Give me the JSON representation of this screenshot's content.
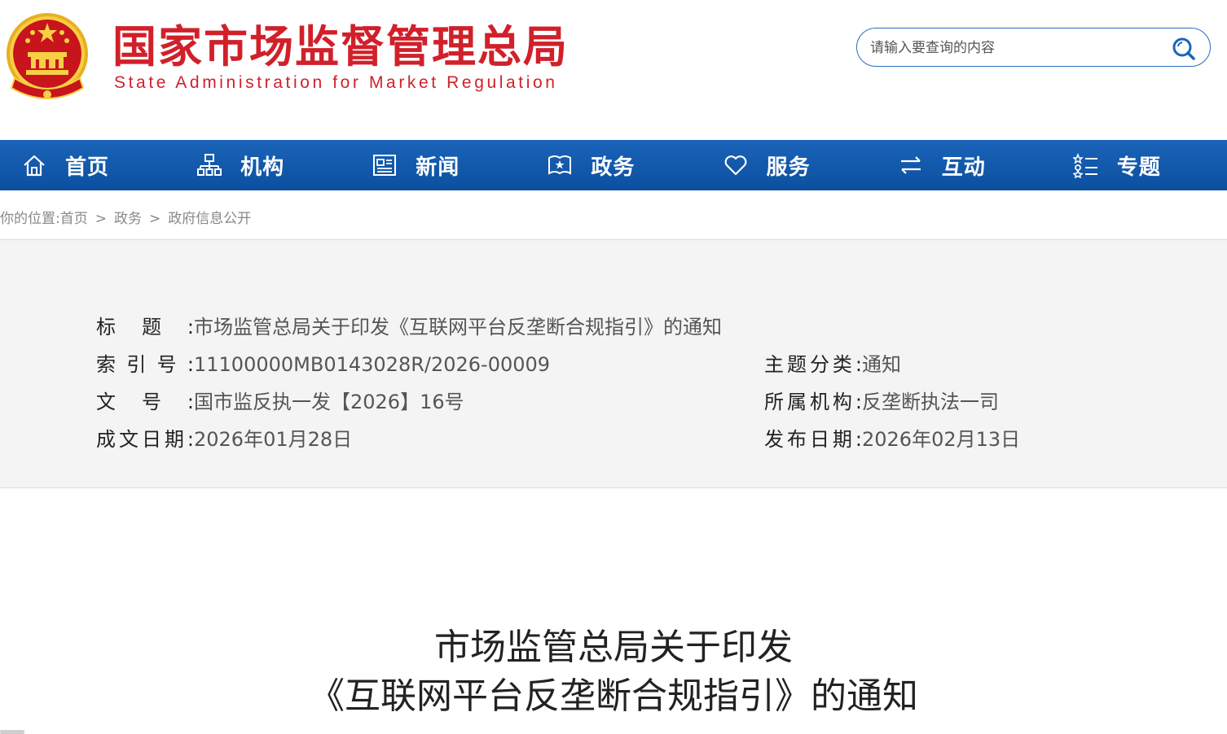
{
  "header": {
    "site_name_cn": "国家市场监督管理总局",
    "site_name_en": "State Administration for Market Regulation",
    "emblem_icon": "national-emblem-icon",
    "search": {
      "placeholder": "请输入要查询的内容",
      "icon": "search-icon"
    }
  },
  "nav": {
    "items": [
      {
        "label": "首页",
        "icon": "home-icon"
      },
      {
        "label": "机构",
        "icon": "org-chart-icon"
      },
      {
        "label": "新闻",
        "icon": "news-icon"
      },
      {
        "label": "政务",
        "icon": "government-affairs-icon"
      },
      {
        "label": "服务",
        "icon": "heart-icon"
      },
      {
        "label": "互动",
        "icon": "exchange-arrows-icon"
      },
      {
        "label": "专题",
        "icon": "topic-list-icon"
      }
    ]
  },
  "breadcrumb": {
    "prefix": "你的位置:",
    "items": [
      "首页",
      "政务",
      "政府信息公开"
    ],
    "separator": ">"
  },
  "info": {
    "title_label": "标题:",
    "title_value": "市场监管总局关于印发《互联网平台反垄断合规指引》的通知",
    "index_label": "索引号:",
    "index_value": "11100000MB0143028R/2026-00009",
    "category_label": "主题分类:",
    "category_value": "通知",
    "docno_label": "文号:",
    "docno_value": "国市监反执一发【2026】16号",
    "org_label": "所属机构:",
    "org_value": "反垄断执法一司",
    "written_label": "成文日期:",
    "written_value": "2026年01月28日",
    "published_label": "发布日期:",
    "published_value": "2026年02月13日"
  },
  "article": {
    "title_line1": "市场监管总局关于印发",
    "title_line2": "《互联网平台反垄断合规指引》的通知"
  },
  "colors": {
    "brand_red": "#d1202a",
    "nav_blue": "#1a64b8",
    "search_border": "#2a6cc0",
    "info_bg": "#f4f4f4"
  }
}
